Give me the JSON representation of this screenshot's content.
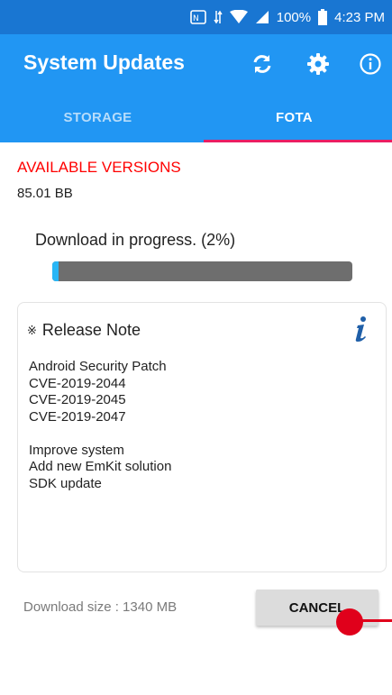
{
  "status_bar": {
    "icons": [
      "nfc-icon",
      "data-arrows-icon",
      "wifi-icon",
      "cell-signal-icon",
      "battery-icon"
    ],
    "battery": "100%",
    "time": "4:23 PM"
  },
  "app_bar": {
    "title": "System Updates",
    "actions": [
      "refresh-icon",
      "settings-gear-icon",
      "info-icon"
    ]
  },
  "tabs": [
    {
      "label": "STORAGE",
      "selected": false
    },
    {
      "label": "FOTA",
      "selected": true
    }
  ],
  "available": {
    "title": "AVAILABLE VERSIONS",
    "version": "85.01 BB"
  },
  "download": {
    "status": "Download in progress. (2%)",
    "progress_percent": 2
  },
  "release_note": {
    "marker": "※",
    "title": "Release Note",
    "lines": [
      "Android Security Patch",
      "CVE-2019-2044",
      "CVE-2019-2045",
      "CVE-2019-2047",
      "",
      "Improve system",
      "Add new EmKit solution",
      "SDK update"
    ]
  },
  "footer": {
    "download_size": "Download size : 1340 MB",
    "cancel_label": "CANCEL"
  },
  "colors": {
    "status_bar": "#1976d2",
    "app_bar": "#2196f3",
    "tab_indicator": "#e91e63",
    "available_title": "#ff0000",
    "progress_fill": "#29b6f6",
    "progress_track": "#6e6e6e",
    "touch_marker": "#e0001b"
  }
}
